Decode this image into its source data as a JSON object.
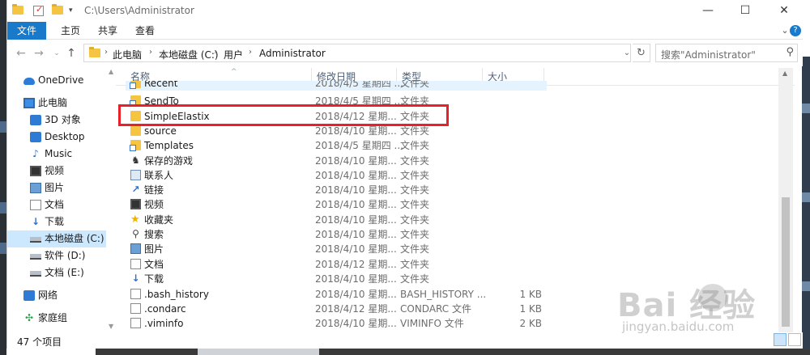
{
  "window": {
    "title": "C:\\Users\\Administrator"
  },
  "ribbon": {
    "tabs": [
      "文件",
      "主页",
      "共享",
      "查看"
    ]
  },
  "address": {
    "crumbs": [
      "此电脑",
      "本地磁盘 (C:)",
      "用户",
      "Administrator"
    ],
    "search_placeholder": "搜索\"Administrator\""
  },
  "sidebar": {
    "items": [
      {
        "label": "OneDrive",
        "icon": "cloud-icon"
      },
      {
        "label": "此电脑",
        "icon": "computer-icon"
      },
      {
        "label": "3D 对象",
        "icon": "3d-objects-icon"
      },
      {
        "label": "Desktop",
        "icon": "desktop-icon"
      },
      {
        "label": "Music",
        "icon": "music-icon"
      },
      {
        "label": "视频",
        "icon": "video-icon"
      },
      {
        "label": "图片",
        "icon": "pictures-icon"
      },
      {
        "label": "文档",
        "icon": "documents-icon"
      },
      {
        "label": "下载",
        "icon": "download-icon"
      },
      {
        "label": "本地磁盘 (C:)",
        "icon": "drive-icon"
      },
      {
        "label": "软件 (D:)",
        "icon": "drive-icon"
      },
      {
        "label": "文档 (E:)",
        "icon": "drive-icon"
      },
      {
        "label": "网络",
        "icon": "network-icon"
      },
      {
        "label": "家庭组",
        "icon": "homegroup-icon"
      }
    ]
  },
  "columns": [
    "名称",
    "修改日期",
    "类型",
    "大小"
  ],
  "files": [
    {
      "name": "Recent",
      "date": "2018/4/5 星期四 ...",
      "type": "文件夹",
      "size": "",
      "icon": "shortcut-folder-icon"
    },
    {
      "name": "SendTo",
      "date": "2018/4/5 星期四 ...",
      "type": "文件夹",
      "size": "",
      "icon": "shortcut-folder-icon"
    },
    {
      "name": "SimpleElastix",
      "date": "2018/4/12 星期...",
      "type": "文件夹",
      "size": "",
      "icon": "folder-icon"
    },
    {
      "name": "source",
      "date": "2018/4/10 星期...",
      "type": "文件夹",
      "size": "",
      "icon": "folder-icon"
    },
    {
      "name": "Templates",
      "date": "2018/4/5 星期四 ...",
      "type": "文件夹",
      "size": "",
      "icon": "shortcut-folder-icon"
    },
    {
      "name": "保存的游戏",
      "date": "2018/4/10 星期...",
      "type": "文件夹",
      "size": "",
      "icon": "saved-games-icon"
    },
    {
      "name": "联系人",
      "date": "2018/4/10 星期...",
      "type": "文件夹",
      "size": "",
      "icon": "contacts-icon"
    },
    {
      "name": "链接",
      "date": "2018/4/10 星期...",
      "type": "文件夹",
      "size": "",
      "icon": "links-icon"
    },
    {
      "name": "视频",
      "date": "2018/4/10 星期...",
      "type": "文件夹",
      "size": "",
      "icon": "video-icon"
    },
    {
      "name": "收藏夹",
      "date": "2018/4/10 星期...",
      "type": "文件夹",
      "size": "",
      "icon": "favorites-icon"
    },
    {
      "name": "搜索",
      "date": "2018/4/10 星期...",
      "type": "文件夹",
      "size": "",
      "icon": "search-folder-icon"
    },
    {
      "name": "图片",
      "date": "2018/4/10 星期...",
      "type": "文件夹",
      "size": "",
      "icon": "pictures-icon"
    },
    {
      "name": "文档",
      "date": "2018/4/12 星期...",
      "type": "文件夹",
      "size": "",
      "icon": "documents-icon"
    },
    {
      "name": "下载",
      "date": "2018/4/10 星期...",
      "type": "文件夹",
      "size": "",
      "icon": "download-icon"
    },
    {
      "name": ".bash_history",
      "date": "2018/4/10 星期...",
      "type": "BASH_HISTORY ...",
      "size": "1 KB",
      "icon": "file-icon"
    },
    {
      "name": ".condarc",
      "date": "2018/4/12 星期...",
      "type": "CONDARC 文件",
      "size": "1 KB",
      "icon": "file-icon"
    },
    {
      "name": ".viminfo",
      "date": "2018/4/10 星期...",
      "type": "VIMINFO 文件",
      "size": "2 KB",
      "icon": "file-icon"
    }
  ],
  "status": {
    "item_count": "47 个项目"
  },
  "watermark": {
    "brand": "Bai  经验",
    "url": "jingyan.baidu.com"
  },
  "colors": {
    "accent": "#1979ca",
    "highlight": "#e8202a",
    "selection": "#cce8ff"
  }
}
